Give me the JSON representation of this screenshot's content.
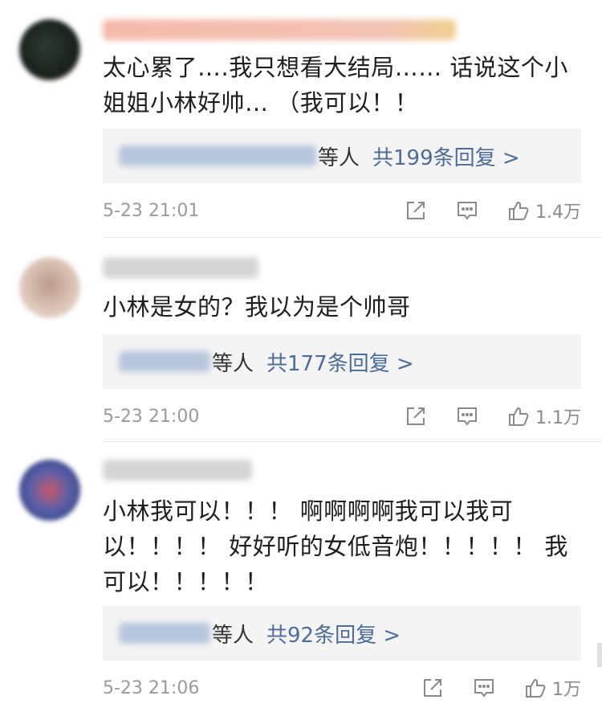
{
  "comments": [
    {
      "text": "太心累了….我只想看大结局……  话说这个小姐姐小林好帅…  （我可以！！",
      "reply_suffix": "等人",
      "reply_count": "共199条回复 >",
      "timestamp": "5-23 21:01",
      "likes": "1.4万"
    },
    {
      "text": "小林是女的？我以为是个帅哥",
      "reply_suffix": "等人",
      "reply_count": "共177条回复 >",
      "timestamp": "5-23 21:00",
      "likes": "1.1万"
    },
    {
      "text": "小林我可以！！！ 啊啊啊啊我可以我可以！！！！ 好好听的女低音炮！！！！！ 我可以！！！！！",
      "reply_suffix": "等人",
      "reply_count": "共92条回复 >",
      "timestamp": "5-23 21:06",
      "likes": "1万"
    }
  ],
  "icons": {
    "share": "share-icon",
    "comment": "comment-icon",
    "like": "thumbs-up-icon"
  },
  "colors": {
    "link": "#4a6d9c",
    "meta": "#9a9a9a",
    "reply_bg": "#f4f4f4"
  }
}
